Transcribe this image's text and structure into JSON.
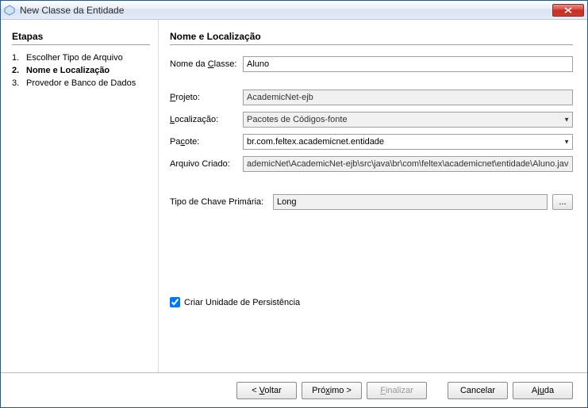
{
  "window": {
    "title": "New Classe da Entidade"
  },
  "sidebar": {
    "heading": "Etapas",
    "steps": [
      {
        "num": "1.",
        "label": "Escolher Tipo de Arquivo"
      },
      {
        "num": "2.",
        "label": "Nome e Localização"
      },
      {
        "num": "3.",
        "label": "Provedor e Banco de Dados"
      }
    ]
  },
  "main": {
    "heading": "Nome e Localização",
    "className": {
      "label_pre": "Nome da ",
      "label_ul": "C",
      "label_post": "lasse:",
      "value": "Aluno"
    },
    "project": {
      "label_ul": "P",
      "label_post": "rojeto:",
      "value": "AcademicNet-ejb"
    },
    "location": {
      "label_ul": "L",
      "label_post": "ocalização:",
      "value": "Pacotes de Códigos-fonte"
    },
    "package": {
      "label_pre": "Pa",
      "label_ul": "c",
      "label_post": "ote:",
      "value": "br.com.feltex.academicnet.entidade"
    },
    "createdFile": {
      "label": "Arquivo Criado:",
      "value": "ademicNet\\AcademicNet-ejb\\src\\java\\br\\com\\feltex\\academicnet\\entidade\\Aluno.java"
    },
    "pkType": {
      "label_ul": "T",
      "label_post": "ipo de Chave Primária:",
      "value": "Long",
      "browse": "..."
    },
    "persistence": {
      "label": "Criar Unidade de Persistência",
      "checked": true
    }
  },
  "footer": {
    "back": {
      "pre": "< ",
      "ul": "V",
      "post": "oltar"
    },
    "next": {
      "pre": "Pró",
      "ul": "x",
      "post": "imo >"
    },
    "finish": {
      "ul": "F",
      "post": "inalizar"
    },
    "cancel": {
      "label": "Cancelar"
    },
    "help": {
      "pre": "Aj",
      "ul": "u",
      "post": "da"
    }
  }
}
